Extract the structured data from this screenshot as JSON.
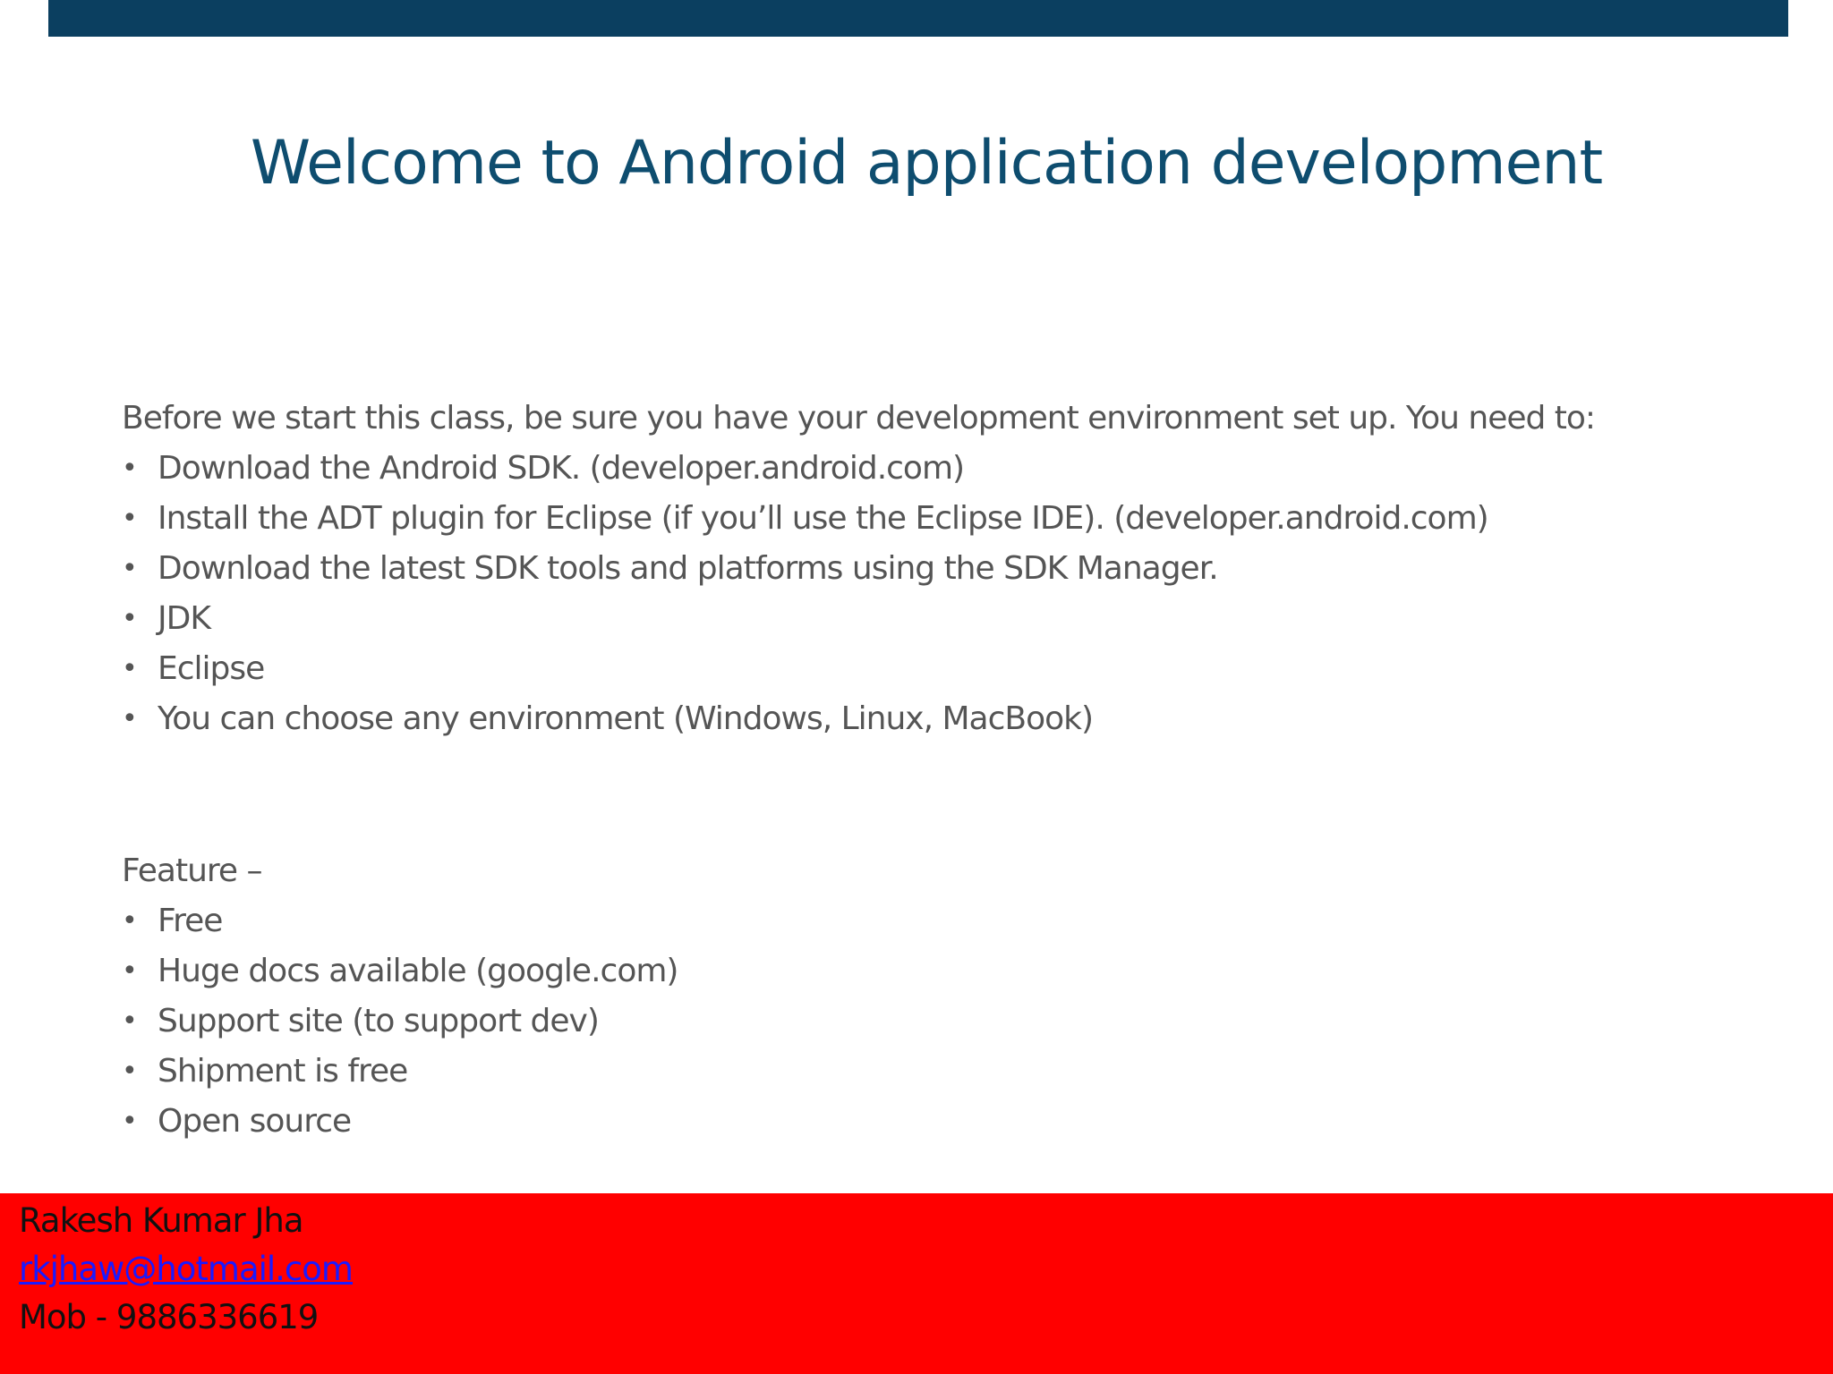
{
  "slide": {
    "title": "Welcome to Android application development",
    "intro": "Before we start this class, be sure you have your development environment set up. You need to:",
    "setup_items": [
      "Download the Android SDK. (developer.android.com)",
      "Install the ADT plugin for Eclipse (if you’ll use the Eclipse IDE). (developer.android.com)",
      "Download the latest SDK tools and platforms using the SDK Manager.",
      "JDK",
      "Eclipse",
      "You can choose any environment (Windows,  Linux, MacBook)"
    ],
    "feature_heading": "Feature –",
    "feature_items": [
      "Free",
      "Huge docs available (google.com)",
      "Support site (to support dev)",
      "Shipment is free",
      "Open source"
    ],
    "bullet_glyph": "•"
  },
  "footer": {
    "name": "Rakesh Kumar Jha",
    "email": "rkjhaw@hotmail.com",
    "mobile": "Mob - 9886336619"
  },
  "colors": {
    "top_bar": "#0b3f60",
    "title": "#0e4d6f",
    "body_text": "#555555",
    "footer_bg": "#ff0000",
    "link": "#1a1aff"
  }
}
